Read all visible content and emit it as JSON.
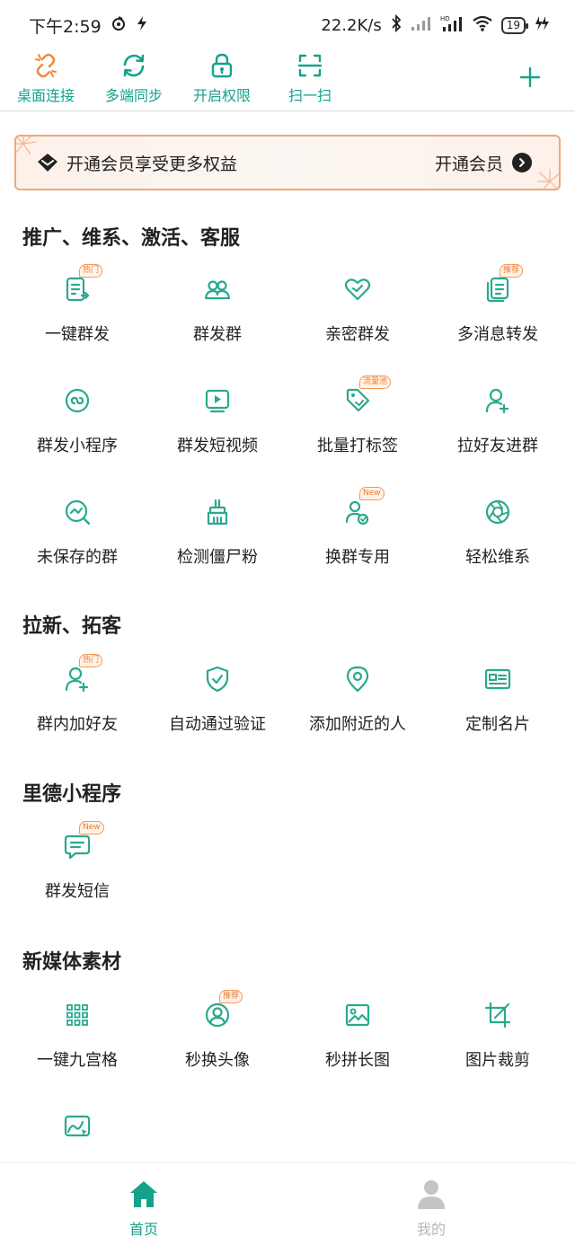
{
  "status_bar": {
    "time": "下午2:59",
    "speed": "22.2K/s",
    "battery": "19"
  },
  "toolbar": {
    "items": [
      {
        "label": "桌面连接",
        "icon": "broken-link-icon"
      },
      {
        "label": "多端同步",
        "icon": "sync-icon"
      },
      {
        "label": "开启权限",
        "icon": "lock-icon"
      },
      {
        "label": "扫一扫",
        "icon": "scan-icon"
      }
    ],
    "add_icon": "plus-icon"
  },
  "vip_banner": {
    "text": "开通会员享受更多权益",
    "cta": "开通会员"
  },
  "sections": [
    {
      "title": "推广、维系、激活、客服",
      "items": [
        {
          "label": "一键群发",
          "icon": "broadcast-doc-icon",
          "badge": "热门"
        },
        {
          "label": "群发群",
          "icon": "group-users-icon",
          "badge": ""
        },
        {
          "label": "亲密群发",
          "icon": "heart-icon",
          "badge": ""
        },
        {
          "label": "多消息转发",
          "icon": "multi-doc-icon",
          "badge": "推荐"
        },
        {
          "label": "群发小程序",
          "icon": "mini-program-icon",
          "badge": ""
        },
        {
          "label": "群发短视频",
          "icon": "video-icon",
          "badge": ""
        },
        {
          "label": "批量打标签",
          "icon": "tag-icon",
          "badge": "流量池"
        },
        {
          "label": "拉好友进群",
          "icon": "add-user-icon",
          "badge": ""
        },
        {
          "label": "未保存的群",
          "icon": "search-chart-icon",
          "badge": ""
        },
        {
          "label": "检测僵尸粉",
          "icon": "broom-icon",
          "badge": ""
        },
        {
          "label": "换群专用",
          "icon": "switch-users-icon",
          "badge": "New"
        },
        {
          "label": "轻松维系",
          "icon": "aperture-icon",
          "badge": ""
        }
      ]
    },
    {
      "title": "拉新、拓客",
      "items": [
        {
          "label": "群内加好友",
          "icon": "add-friend-icon",
          "badge": "热门"
        },
        {
          "label": "自动通过验证",
          "icon": "shield-check-icon",
          "badge": ""
        },
        {
          "label": "添加附近的人",
          "icon": "location-pin-icon",
          "badge": ""
        },
        {
          "label": "定制名片",
          "icon": "card-icon",
          "badge": ""
        }
      ]
    },
    {
      "title": "里德小程序",
      "items": [
        {
          "label": "群发短信",
          "icon": "message-icon",
          "badge": "New"
        }
      ]
    },
    {
      "title": "新媒体素材",
      "items": [
        {
          "label": "一键九宫格",
          "icon": "nine-grid-icon",
          "badge": ""
        },
        {
          "label": "秒换头像",
          "icon": "avatar-icon",
          "badge": "推荐"
        },
        {
          "label": "秒拼长图",
          "icon": "image-icon",
          "badge": ""
        },
        {
          "label": "图片裁剪",
          "icon": "crop-icon",
          "badge": ""
        },
        {
          "label": "",
          "icon": "image-chart-icon",
          "badge": ""
        }
      ]
    }
  ],
  "bottom_nav": [
    {
      "label": "首页",
      "icon": "home-icon",
      "active": true
    },
    {
      "label": "我的",
      "icon": "profile-icon",
      "active": false
    }
  ],
  "colors": {
    "accent": "#13a38a",
    "icon_green": "#2aa98e",
    "badge_orange": "#f37b2c",
    "vip_border": "#f0a878"
  }
}
